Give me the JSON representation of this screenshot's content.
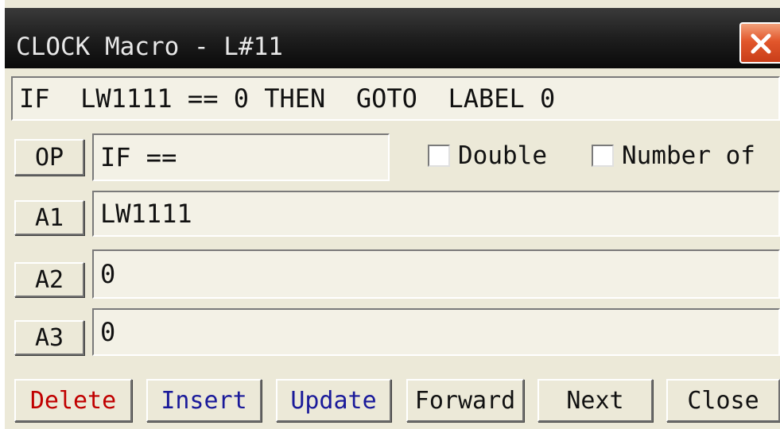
{
  "window": {
    "title": "CLOCK Macro - L#11",
    "close_icon": "close-x-icon",
    "colors": {
      "close": "#d9532a",
      "delete_text": "#c00000",
      "insert_text": "#1a1a9a",
      "update_text": "#1a1a9a"
    }
  },
  "statement": "IF  LW1111 == 0 THEN  GOTO  LABEL 0",
  "op": {
    "button_label": "OP",
    "value": "IF =="
  },
  "options": {
    "double": {
      "label": "Double",
      "checked": false
    },
    "number_of": {
      "label": "Number of",
      "checked": false
    }
  },
  "args": [
    {
      "button_label": "A1",
      "value": "LW1111"
    },
    {
      "button_label": "A2",
      "value": "0"
    },
    {
      "button_label": "A3",
      "value": "0"
    }
  ],
  "actions": {
    "delete": "Delete",
    "insert": "Insert",
    "update": "Update",
    "forward": "Forward",
    "next": "Next",
    "close": "Close"
  }
}
